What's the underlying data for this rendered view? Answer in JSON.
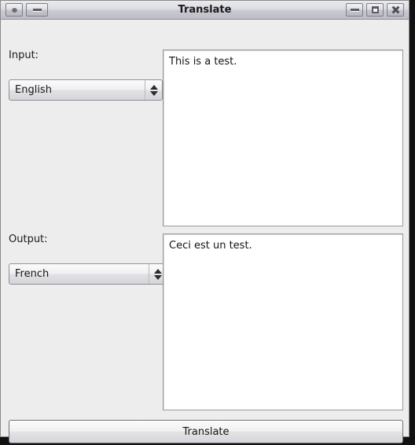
{
  "window": {
    "title": "Translate",
    "titlebar_buttons": {
      "left": [
        {
          "name": "window-menu-button",
          "icon": "circle-dot-icon"
        },
        {
          "name": "shade-button",
          "icon": "dash-icon"
        }
      ],
      "right": [
        {
          "name": "minimize-button",
          "icon": "minimize-icon"
        },
        {
          "name": "maximize-button",
          "icon": "maximize-icon"
        },
        {
          "name": "close-button",
          "icon": "close-icon"
        }
      ]
    }
  },
  "input_section": {
    "label": "Input:",
    "language_selected": "English",
    "text": "This is a test."
  },
  "output_section": {
    "label": "Output:",
    "language_selected": "French",
    "text": "Ceci est un test."
  },
  "actions": {
    "translate_label": "Translate"
  },
  "colors": {
    "window_background": "#ededed",
    "titlebar_top": "#e9e9ef",
    "titlebar_bottom": "#bdbdc6",
    "text_field_background": "#ffffff",
    "border": "#8f8f97",
    "text": "#161616"
  }
}
